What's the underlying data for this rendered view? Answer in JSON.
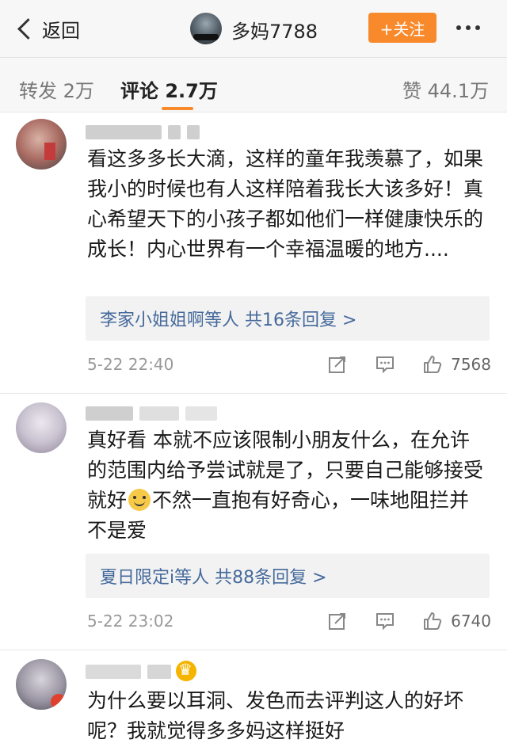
{
  "header": {
    "back_label": "返回",
    "username": "多妈7788",
    "follow_label": "+关注"
  },
  "tabs": {
    "repost": "转发 2万",
    "comment": "评论 2.7万",
    "like": "赞 44.1万"
  },
  "comments": [
    {
      "text": "看这多多长大滴，这样的童年我羡慕了，如果我小的时候也有人这样陪着我长大该多好！真心希望天下的小孩子都如他们一样健康快乐的成长！内心世界有一个幸福温暖的地方....",
      "replies": "李家小姐姐啊等人  共16条回复 >",
      "time": "5-22 22:40",
      "likes": "7568"
    },
    {
      "text_before_emoji": "真好看 本就不应该限制小朋友什么，在允许的范围内给予尝试就是了，只要自己能够接受就好",
      "text_after_emoji": "不然一直抱有好奇心，一味地阻拦并不是爱",
      "replies": "夏日限定i等人  共88条回复 >",
      "time": "5-22 23:02",
      "likes": "6740"
    },
    {
      "text": "为什么要以耳洞、发色而去评判这人的好坏呢？我就觉得多多妈这样挺好"
    }
  ],
  "icons": {
    "back": "chevron-left-icon",
    "more": "more-dots-icon",
    "repost": "repost-icon",
    "reply": "comment-icon",
    "like": "thumbs-up-icon",
    "emoji": "smile-emoji-icon",
    "crown": "crown-icon"
  },
  "colors": {
    "accent": "#f88a2c",
    "link": "#466a9c"
  }
}
